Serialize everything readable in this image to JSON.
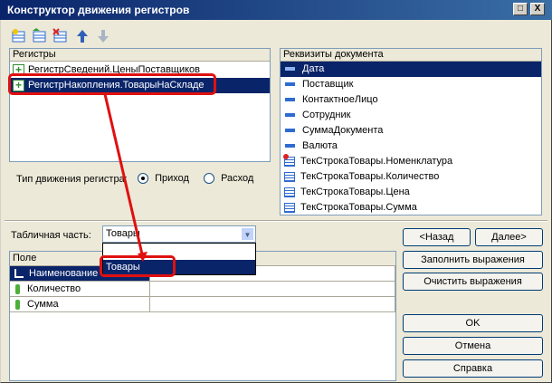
{
  "window": {
    "title": "Конструктор движения регистров"
  },
  "registers_panel": {
    "header": "Регистры",
    "items": [
      {
        "label": "РегистрСведений.ЦеныПоставщиков",
        "selected": false
      },
      {
        "label": "РегистрНакопления.ТоварыНаСкладе",
        "selected": true
      }
    ]
  },
  "movement_type": {
    "label": "Тип движения регистра:",
    "options": [
      {
        "label": "Приход",
        "selected": true
      },
      {
        "label": "Расход",
        "selected": false
      }
    ]
  },
  "attributes_panel": {
    "header": "Реквизиты документа",
    "items": [
      {
        "label": "Дата",
        "icon": "attribute-icon",
        "selected": true
      },
      {
        "label": "Поставщик",
        "icon": "attribute-icon",
        "selected": false
      },
      {
        "label": "КонтактноеЛицо",
        "icon": "attribute-icon",
        "selected": false
      },
      {
        "label": "Сотрудник",
        "icon": "attribute-icon",
        "selected": false
      },
      {
        "label": "СуммаДокумента",
        "icon": "attribute-icon",
        "selected": false
      },
      {
        "label": "Валюта",
        "icon": "attribute-icon",
        "selected": false
      },
      {
        "label": "ТекСтрокаТовары.Номенклатура",
        "icon": "table-row-icon",
        "selected": false
      },
      {
        "label": "ТекСтрокаТовары.Количество",
        "icon": "table-row-icon",
        "selected": false
      },
      {
        "label": "ТекСтрокаТовары.Цена",
        "icon": "table-row-icon",
        "selected": false
      },
      {
        "label": "ТекСтрокаТовары.Сумма",
        "icon": "table-row-icon",
        "selected": false
      }
    ]
  },
  "tabular_part": {
    "label": "Табличная часть:",
    "value": "Товары",
    "dropdown_option": "Товары"
  },
  "fields_grid": {
    "header": "Поле",
    "rows": [
      {
        "label": "Наименование",
        "icon": "dimension-icon",
        "selected": true
      },
      {
        "label": "Количество",
        "icon": "resource-icon",
        "selected": false
      },
      {
        "label": "Сумма",
        "icon": "resource-icon",
        "selected": false
      }
    ]
  },
  "buttons": {
    "back": "<Назад",
    "next": "Далее>",
    "fill": "Заполнить выражения",
    "clear": "Очистить выражения",
    "ok": "OK",
    "cancel": "Отмена",
    "help": "Справка"
  },
  "title_buttons": {
    "maximize": "□",
    "close": "X"
  },
  "colors": {
    "selection": "#0A246A",
    "highlight": "#E01010",
    "title": "#0A246A"
  }
}
